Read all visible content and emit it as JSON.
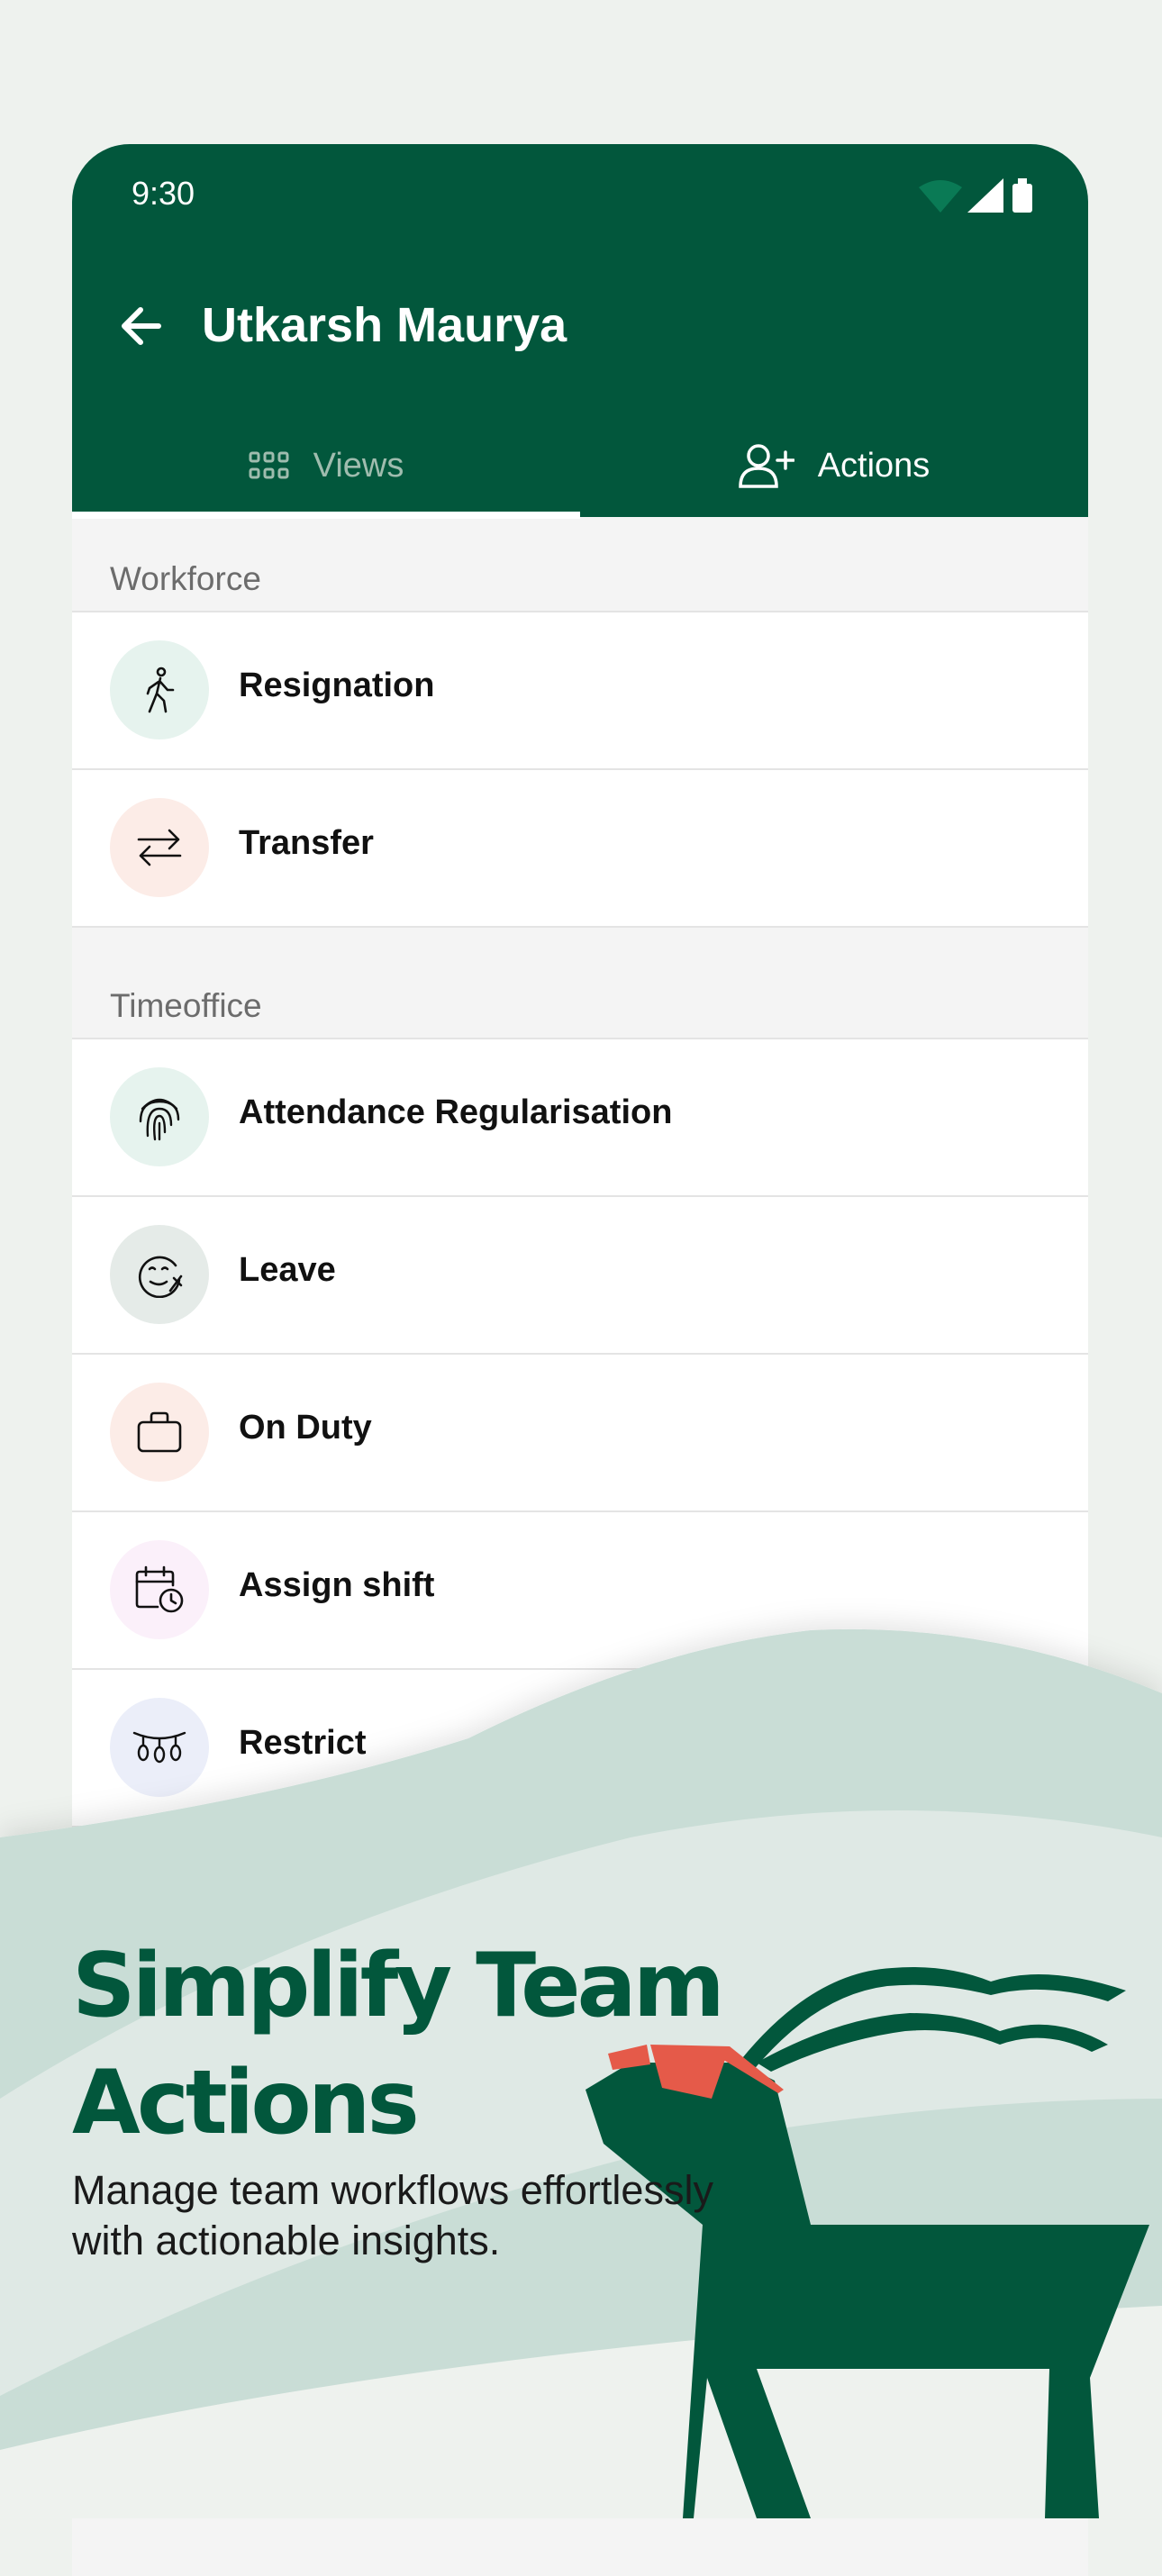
{
  "status": {
    "time": "9:30"
  },
  "header": {
    "title": "Utkarsh Maurya"
  },
  "tabs": [
    {
      "label": "Views",
      "icon": "grid-icon",
      "selected": false
    },
    {
      "label": "Actions",
      "icon": "add-user-icon",
      "selected": true
    }
  ],
  "sections": [
    {
      "title": "Workforce",
      "items": [
        {
          "label": "Resignation",
          "icon": "walking-person-icon",
          "tint": "#e6f3ee"
        },
        {
          "label": "Transfer",
          "icon": "swap-arrows-icon",
          "tint": "#fcece7"
        }
      ]
    },
    {
      "title": "Timeoffice",
      "items": [
        {
          "label": "Attendance Regularisation",
          "icon": "fingerprint-icon",
          "tint": "#e6f3ee"
        },
        {
          "label": "Leave",
          "icon": "vacation-face-icon",
          "tint": "#e5ebe8"
        },
        {
          "label": "On Duty",
          "icon": "briefcase-icon",
          "tint": "#fcece7"
        },
        {
          "label": "Assign shift",
          "icon": "calendar-clock-icon",
          "tint": "#fbf0fa"
        },
        {
          "label": "Restrict",
          "icon": "holiday-lights-icon",
          "tint": "#ebeef9"
        }
      ]
    }
  ],
  "promo": {
    "headline_line1": "Simplify Team",
    "headline_line2": "Actions",
    "subtitle_line1": "Manage team workflows effortlessly",
    "subtitle_line2": "with actionable insights."
  },
  "colors": {
    "brand_green": "#02573c",
    "accent_red": "#e55a49",
    "wave": "#c9ddd6"
  }
}
